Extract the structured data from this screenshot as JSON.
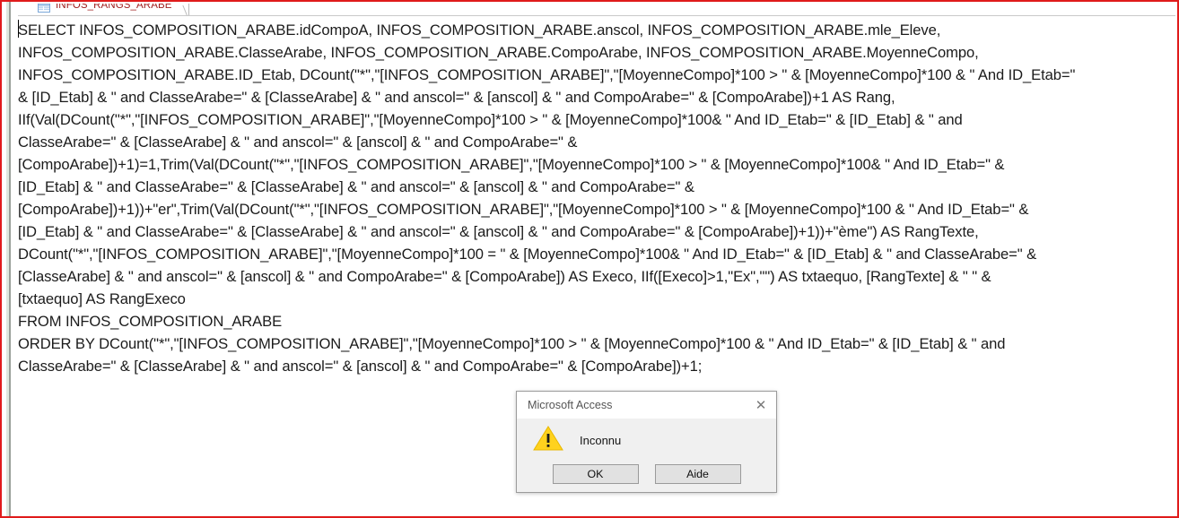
{
  "window": {
    "accent_border_color": "#e01b1b",
    "tab": {
      "label": "INFOS_RANGS_ARABE",
      "icon": "query-sql-icon"
    }
  },
  "sql_editor": {
    "lines": [
      "SELECT INFOS_COMPOSITION_ARABE.idCompoA, INFOS_COMPOSITION_ARABE.anscol, INFOS_COMPOSITION_ARABE.mle_Eleve,",
      "INFOS_COMPOSITION_ARABE.ClasseArabe, INFOS_COMPOSITION_ARABE.CompoArabe, INFOS_COMPOSITION_ARABE.MoyenneCompo,",
      "INFOS_COMPOSITION_ARABE.ID_Etab, DCount(\"*\",\"[INFOS_COMPOSITION_ARABE]\",\"[MoyenneCompo]*100 > \" & [MoyenneCompo]*100 & \" And ID_Etab=\"",
      "& [ID_Etab] & \" and ClasseArabe=\" & [ClasseArabe] & \" and anscol=\" & [anscol] & \" and CompoArabe=\" & [CompoArabe])+1 AS Rang,",
      "IIf(Val(DCount(\"*\",\"[INFOS_COMPOSITION_ARABE]\",\"[MoyenneCompo]*100 > \" & [MoyenneCompo]*100& \" And ID_Etab=\" & [ID_Etab] & \" and",
      "ClasseArabe=\" & [ClasseArabe] & \" and anscol=\" & [anscol] & \" and CompoArabe=\" &",
      "[CompoArabe])+1)=1,Trim(Val(DCount(\"*\",\"[INFOS_COMPOSITION_ARABE]\",\"[MoyenneCompo]*100 > \" & [MoyenneCompo]*100& \" And ID_Etab=\" &",
      "[ID_Etab] & \" and ClasseArabe=\" & [ClasseArabe] & \" and anscol=\" & [anscol] & \" and CompoArabe=\" &",
      "[CompoArabe])+1))+\"er\",Trim(Val(DCount(\"*\",\"[INFOS_COMPOSITION_ARABE]\",\"[MoyenneCompo]*100 > \" & [MoyenneCompo]*100 & \" And ID_Etab=\" &",
      "[ID_Etab] & \" and ClasseArabe=\" & [ClasseArabe] & \" and anscol=\" & [anscol] & \" and CompoArabe=\" & [CompoArabe])+1))+\"ème\") AS RangTexte,",
      "DCount(\"*\",\"[INFOS_COMPOSITION_ARABE]\",\"[MoyenneCompo]*100 = \" & [MoyenneCompo]*100& \" And ID_Etab=\" & [ID_Etab] & \" and ClasseArabe=\" &",
      "[ClasseArabe] & \" and anscol=\" & [anscol] & \" and CompoArabe=\" & [CompoArabe]) AS Execo, IIf([Execo]>1,\"Ex\",\"\") AS txtaequo, [RangTexte] & \" \" &",
      "[txtaequo] AS RangExeco",
      "FROM INFOS_COMPOSITION_ARABE",
      "ORDER BY DCount(\"*\",\"[INFOS_COMPOSITION_ARABE]\",\"[MoyenneCompo]*100 > \" & [MoyenneCompo]*100 & \" And ID_Etab=\" & [ID_Etab] & \" and",
      "ClasseArabe=\" & [ClasseArabe] & \" and anscol=\" & [anscol] & \" and CompoArabe=\" & [CompoArabe])+1;"
    ]
  },
  "dialog": {
    "title": "Microsoft Access",
    "close_label": "✕",
    "icon": "warning-triangle-icon",
    "message": "Inconnu",
    "buttons": [
      {
        "label": "OK",
        "name": "ok-button"
      },
      {
        "label": "Aide",
        "name": "aide-button"
      }
    ]
  }
}
